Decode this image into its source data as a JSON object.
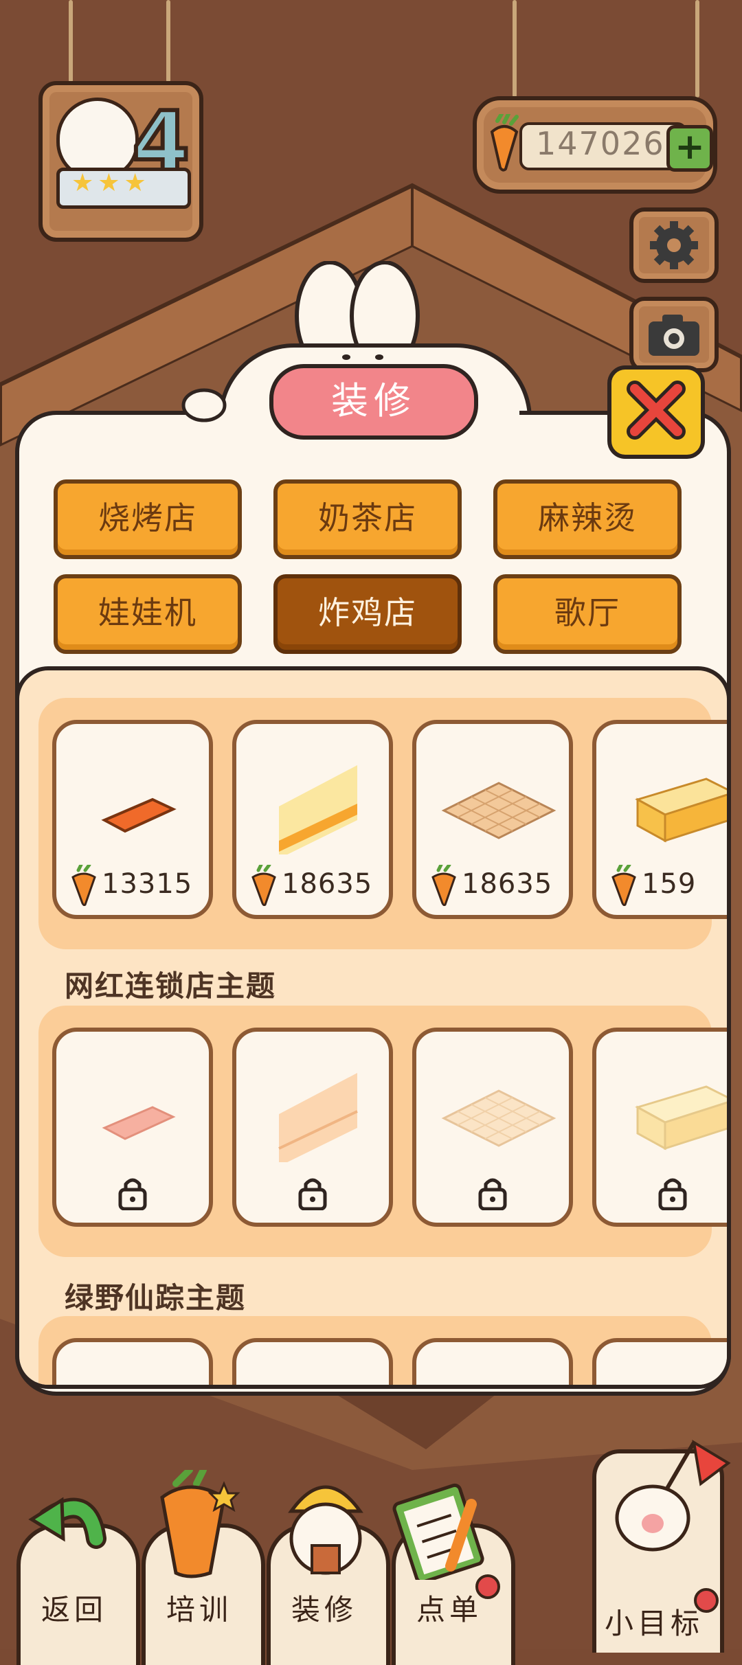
{
  "hud": {
    "level": "4",
    "stars": "★★★",
    "carrots": "147026",
    "plus": "+"
  },
  "dialog": {
    "title": "装修",
    "categories": [
      {
        "label": "烧烤店",
        "selected": false
      },
      {
        "label": "奶茶店",
        "selected": false
      },
      {
        "label": "麻辣烫",
        "selected": false
      },
      {
        "label": "娃娃机",
        "selected": false
      },
      {
        "label": "炸鸡店",
        "selected": true
      },
      {
        "label": "歌厅",
        "selected": false
      }
    ],
    "sections": [
      {
        "title": "",
        "items": [
          {
            "price": "13315",
            "locked": false
          },
          {
            "price": "18635",
            "locked": false
          },
          {
            "price": "18635",
            "locked": false
          },
          {
            "price": "159",
            "locked": false
          }
        ]
      },
      {
        "title": "网红连锁店主题",
        "items": [
          {
            "locked": true
          },
          {
            "locked": true
          },
          {
            "locked": true
          },
          {
            "locked": true
          }
        ]
      },
      {
        "title": "绿野仙踪主题",
        "items": []
      }
    ]
  },
  "nav": {
    "back": "返回",
    "train": "培训",
    "decorate": "装修",
    "order": "点单",
    "goal": "小目标"
  },
  "colors": {
    "accent_orange": "#f7a62f",
    "selected_brown": "#a0530e",
    "title_pink": "#f2858a",
    "close_yellow": "#f6c427",
    "plus_green": "#6fb34b"
  },
  "icons": [
    "carrot-icon",
    "plus-icon",
    "gear-icon",
    "camera-icon",
    "close-icon",
    "lock-icon",
    "back-arrow-icon"
  ]
}
